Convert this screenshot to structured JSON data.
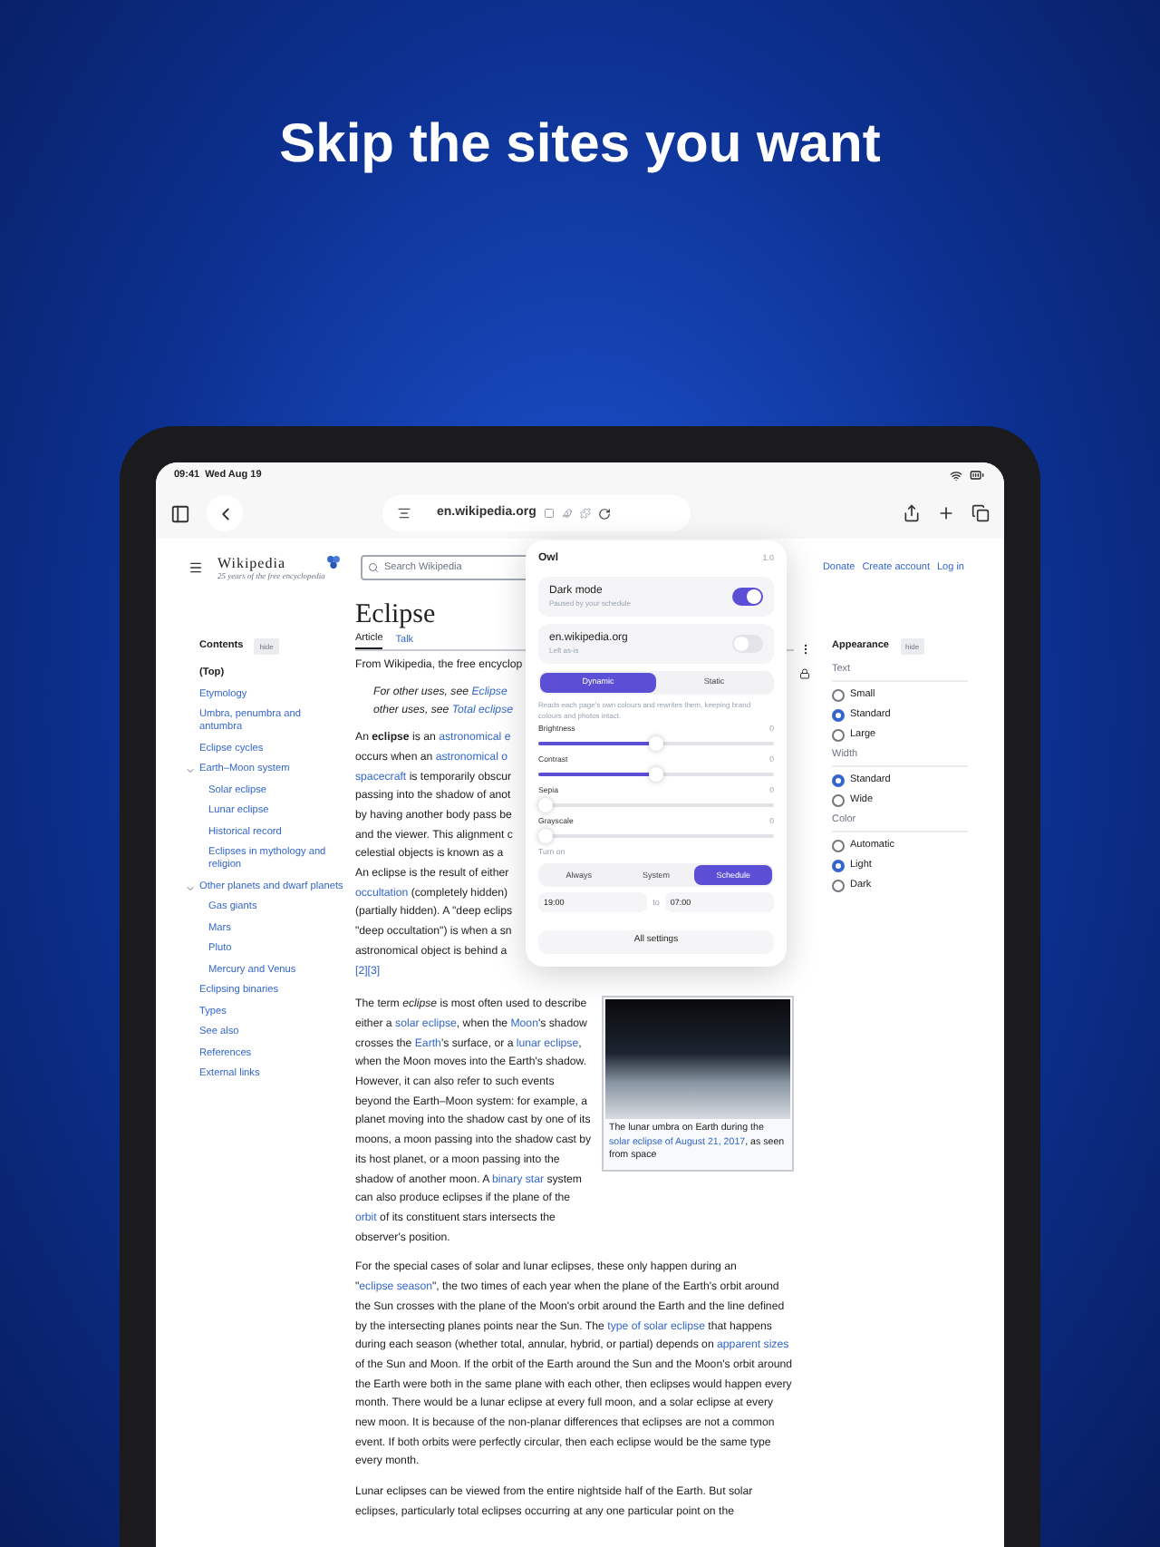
{
  "headline": "Skip the sites you want",
  "status_bar": {
    "time": "09:41",
    "date": "Wed Aug 19"
  },
  "browser": {
    "url": "en.wikipedia.org"
  },
  "wiki_header": {
    "wordmark": "Wikipedia",
    "tagline": "25 years of the free encyclopedia",
    "search": {
      "placeholder": "Search Wikipedia"
    },
    "links": [
      "Donate",
      "Create account",
      "Log in"
    ]
  },
  "contents": {
    "title": "Contents",
    "hide": "hide",
    "items": [
      {
        "label": "(Top)",
        "selected": true
      },
      {
        "label": "Etymology",
        "selected": false
      },
      {
        "label": "Umbra, penumbra and antumbra",
        "selected": false
      },
      {
        "label": "Eclipse cycles",
        "selected": false
      },
      {
        "label": "Earth–Moon system",
        "selected": false,
        "expanded": true,
        "children": [
          {
            "label": "Solar eclipse",
            "selected": false
          },
          {
            "label": "Lunar eclipse",
            "selected": false
          },
          {
            "label": "Historical record",
            "selected": false
          },
          {
            "label": "Eclipses in mythology and religion",
            "selected": false
          }
        ]
      },
      {
        "label": "Other planets and dwarf planets",
        "selected": false,
        "expanded": true,
        "children": [
          {
            "label": "Gas giants",
            "selected": false
          },
          {
            "label": "Mars",
            "selected": false
          },
          {
            "label": "Pluto",
            "selected": false
          },
          {
            "label": "Mercury and Venus",
            "selected": false
          }
        ]
      },
      {
        "label": "Eclipsing binaries",
        "selected": false
      },
      {
        "label": "Types",
        "selected": false
      },
      {
        "label": "See also",
        "selected": false
      },
      {
        "label": "References",
        "selected": false
      },
      {
        "label": "External links",
        "selected": false
      }
    ]
  },
  "article": {
    "title": "Eclipse",
    "tabs": [
      {
        "label": "Article",
        "selected": true
      },
      {
        "label": "Talk",
        "selected": false
      }
    ],
    "visible_lines": [
      {
        "kind": "source",
        "segments": [
          {
            "text": "From Wikipedia, the free encyclop",
            "kind": "text"
          }
        ]
      },
      {
        "kind": "hatnote",
        "segments": [
          {
            "text": "For other uses, see ",
            "kind": "text"
          },
          {
            "text": "Eclipse",
            "kind": "link"
          }
        ]
      },
      {
        "kind": "hatnote",
        "segments": [
          {
            "text": "other uses, see ",
            "kind": "text"
          },
          {
            "text": "Total eclipse",
            "kind": "link"
          }
        ]
      },
      {
        "kind": "first",
        "segments": [
          {
            "text": "An **eclipse** is an ",
            "kind": "text"
          },
          {
            "text": "astronomical e",
            "kind": "link"
          }
        ]
      },
      {
        "kind": "text",
        "segments": [
          {
            "text": "occurs when an ",
            "kind": "text"
          },
          {
            "text": "astronomical o",
            "kind": "link"
          }
        ]
      },
      {
        "kind": "text",
        "segments": [
          {
            "text": "spacecraft",
            "kind": "link"
          },
          {
            "text": " is temporarily obscur",
            "kind": "text"
          }
        ]
      },
      {
        "kind": "text",
        "segments": [
          {
            "text": "passing into the shadow of anot",
            "kind": "text"
          }
        ]
      },
      {
        "kind": "text",
        "segments": [
          {
            "text": "by having another body pass be",
            "kind": "text"
          }
        ]
      },
      {
        "kind": "text",
        "segments": [
          {
            "text": "and the viewer. This alignment c",
            "kind": "text"
          }
        ]
      },
      {
        "kind": "text",
        "segments": [
          {
            "text": "celestial objects is known as a",
            "kind": "text"
          }
        ]
      },
      {
        "kind": "text",
        "segments": [
          {
            "text": "An eclipse is the result of either",
            "kind": "text"
          }
        ]
      },
      {
        "kind": "text",
        "segments": [
          {
            "text": "occultation",
            "kind": "link"
          },
          {
            "text": " (completely hidden)",
            "kind": "text"
          }
        ]
      },
      {
        "kind": "text",
        "segments": [
          {
            "text": "(partially hidden). A \"deep eclips",
            "kind": "text"
          }
        ]
      },
      {
        "kind": "text",
        "segments": [
          {
            "text": "\"deep occultation\") is when a sn",
            "kind": "text"
          }
        ]
      },
      {
        "kind": "text",
        "segments": [
          {
            "text": "astronomical object is behind a",
            "kind": "text"
          }
        ]
      },
      {
        "kind": "text",
        "segments": [
          {
            "text": "[2][3]",
            "kind": "link"
          }
        ]
      }
    ],
    "figure": {
      "caption": [
        {
          "text": "The lunar umbra on Earth during the ",
          "kind": "text"
        },
        {
          "text": "solar eclipse of August 21, 2017",
          "kind": "link"
        },
        {
          "text": ", as seen from space",
          "kind": "text"
        }
      ]
    },
    "paragraphs": [
      [
        {
          "text": "The term *eclipse* is most often used to describe either a ",
          "kind": "text"
        },
        {
          "text": "solar eclipse",
          "kind": "link"
        },
        {
          "text": ", when the ",
          "kind": "text"
        },
        {
          "text": "Moon",
          "kind": "link"
        },
        {
          "text": "'s shadow crosses the ",
          "kind": "text"
        },
        {
          "text": "Earth",
          "kind": "link"
        },
        {
          "text": "'s surface, or a ",
          "kind": "text"
        },
        {
          "text": "lunar eclipse",
          "kind": "link"
        },
        {
          "text": ", when the Moon moves into the Earth's shadow. However, it can also refer to such events beyond the Earth–Moon system: for example, a planet moving into the shadow cast by one of its moons, a moon passing into the shadow cast by its host planet, or a moon passing into the shadow of another moon. A ",
          "kind": "text"
        },
        {
          "text": "binary star",
          "kind": "link"
        },
        {
          "text": " system can also produce eclipses if the plane of the ",
          "kind": "text"
        },
        {
          "text": "orbit",
          "kind": "link"
        },
        {
          "text": " of its constituent stars intersects the observer's position.",
          "kind": "text"
        }
      ],
      [
        {
          "text": "For the special cases of solar and lunar eclipses, these only happen during an \"",
          "kind": "text"
        },
        {
          "text": "eclipse season",
          "kind": "link"
        },
        {
          "text": "\", the two times of each year when the plane of the Earth's orbit around the Sun crosses with the plane of the Moon's orbit around the Earth and the line defined by the intersecting planes points near the Sun. The ",
          "kind": "text"
        },
        {
          "text": "type of solar eclipse",
          "kind": "link"
        },
        {
          "text": " that happens during each season (whether total, annular, hybrid, or partial) depends on ",
          "kind": "text"
        },
        {
          "text": "apparent sizes",
          "kind": "link"
        },
        {
          "text": " of the Sun and Moon. If the orbit of the Earth around the Sun and the Moon's orbit around the Earth were both in the same plane with each other, then eclipses would happen every month. There would be a lunar eclipse at every full moon, and a solar eclipse at every new moon. It is because of the non-planar differences that eclipses are not a common event. If both orbits were perfectly circular, then each eclipse would be the same type every month.",
          "kind": "text"
        }
      ],
      [
        {
          "text": "Lunar eclipses can be viewed from the entire nightside half of the Earth. But solar eclipses, particularly total eclipses occurring at any one particular point on the",
          "kind": "text"
        }
      ]
    ]
  },
  "appearance": {
    "title": "Appearance",
    "hide": "hide",
    "groups": [
      {
        "label": "Text",
        "options": [
          {
            "label": "Small",
            "selected": false
          },
          {
            "label": "Standard",
            "selected": true
          },
          {
            "label": "Large",
            "selected": false
          }
        ]
      },
      {
        "label": "Width",
        "options": [
          {
            "label": "Standard",
            "selected": true
          },
          {
            "label": "Wide",
            "selected": false
          }
        ]
      },
      {
        "label": "Color",
        "options": [
          {
            "label": "Automatic",
            "selected": false
          },
          {
            "label": "Light",
            "selected": true
          },
          {
            "label": "Dark",
            "selected": false
          }
        ]
      }
    ]
  },
  "owl_popup": {
    "title": "Owl",
    "version": "1.0",
    "toggles": [
      {
        "label": "Dark mode",
        "sublabel": "Paused by your schedule",
        "on": true
      },
      {
        "label": "en.wikipedia.org",
        "sublabel": "Left as-is",
        "on": false
      }
    ],
    "modes": [
      {
        "label": "Dynamic",
        "selected": true
      },
      {
        "label": "Static",
        "selected": false
      }
    ],
    "description": "Reads each page's own colours and rewrites them, keeping brand colours and photos intact.",
    "sliders": [
      {
        "label": "Brightness",
        "reading": "0",
        "level": 0.5
      },
      {
        "label": "Contrast",
        "reading": "0",
        "level": 0.5
      },
      {
        "label": "Sepia",
        "reading": "0",
        "level": 0
      },
      {
        "label": "Grayscale",
        "reading": "0",
        "level": 0
      }
    ],
    "turn_on": {
      "label": "Turn on",
      "options": [
        {
          "label": "Always",
          "selected": false
        },
        {
          "label": "System",
          "selected": false
        },
        {
          "label": "Schedule",
          "selected": true
        }
      ],
      "from": "19:00",
      "separator": "to",
      "to": "07:00"
    },
    "all_settings": "All settings"
  }
}
